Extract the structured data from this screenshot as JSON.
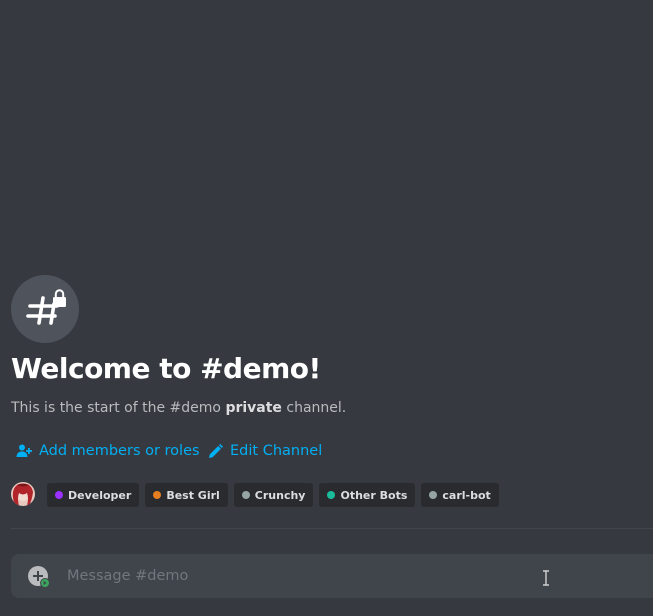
{
  "welcome": {
    "icon": "hashtag-lock-icon",
    "title": "Welcome to #demo!",
    "desc_prefix": "This is the start of the #demo ",
    "desc_bold": "private",
    "desc_suffix": " channel."
  },
  "actions": {
    "add_members": "Add members or roles",
    "add_members_icon": "add-person-icon",
    "edit_channel": "Edit Channel",
    "edit_channel_icon": "pencil-icon",
    "link_color": "#00b0f4"
  },
  "members": {
    "avatar_icon": "member-avatar",
    "roles": [
      {
        "name": "Developer",
        "color": "#9b30ff"
      },
      {
        "name": "Best Girl",
        "color": "#e67e22"
      },
      {
        "name": "Crunchy",
        "color": "#95a5a6"
      },
      {
        "name": "Other Bots",
        "color": "#1abc9c"
      },
      {
        "name": "carl-bot",
        "color": "#95a5a6"
      }
    ]
  },
  "composer": {
    "placeholder": "Message #demo",
    "value": "",
    "attach_icon": "plus-circle-icon"
  },
  "colors": {
    "background": "#36393f",
    "input_background": "#40444b",
    "pill_background": "#292b2f",
    "title": "#ffffff",
    "muted_text": "#b9bbbe"
  }
}
